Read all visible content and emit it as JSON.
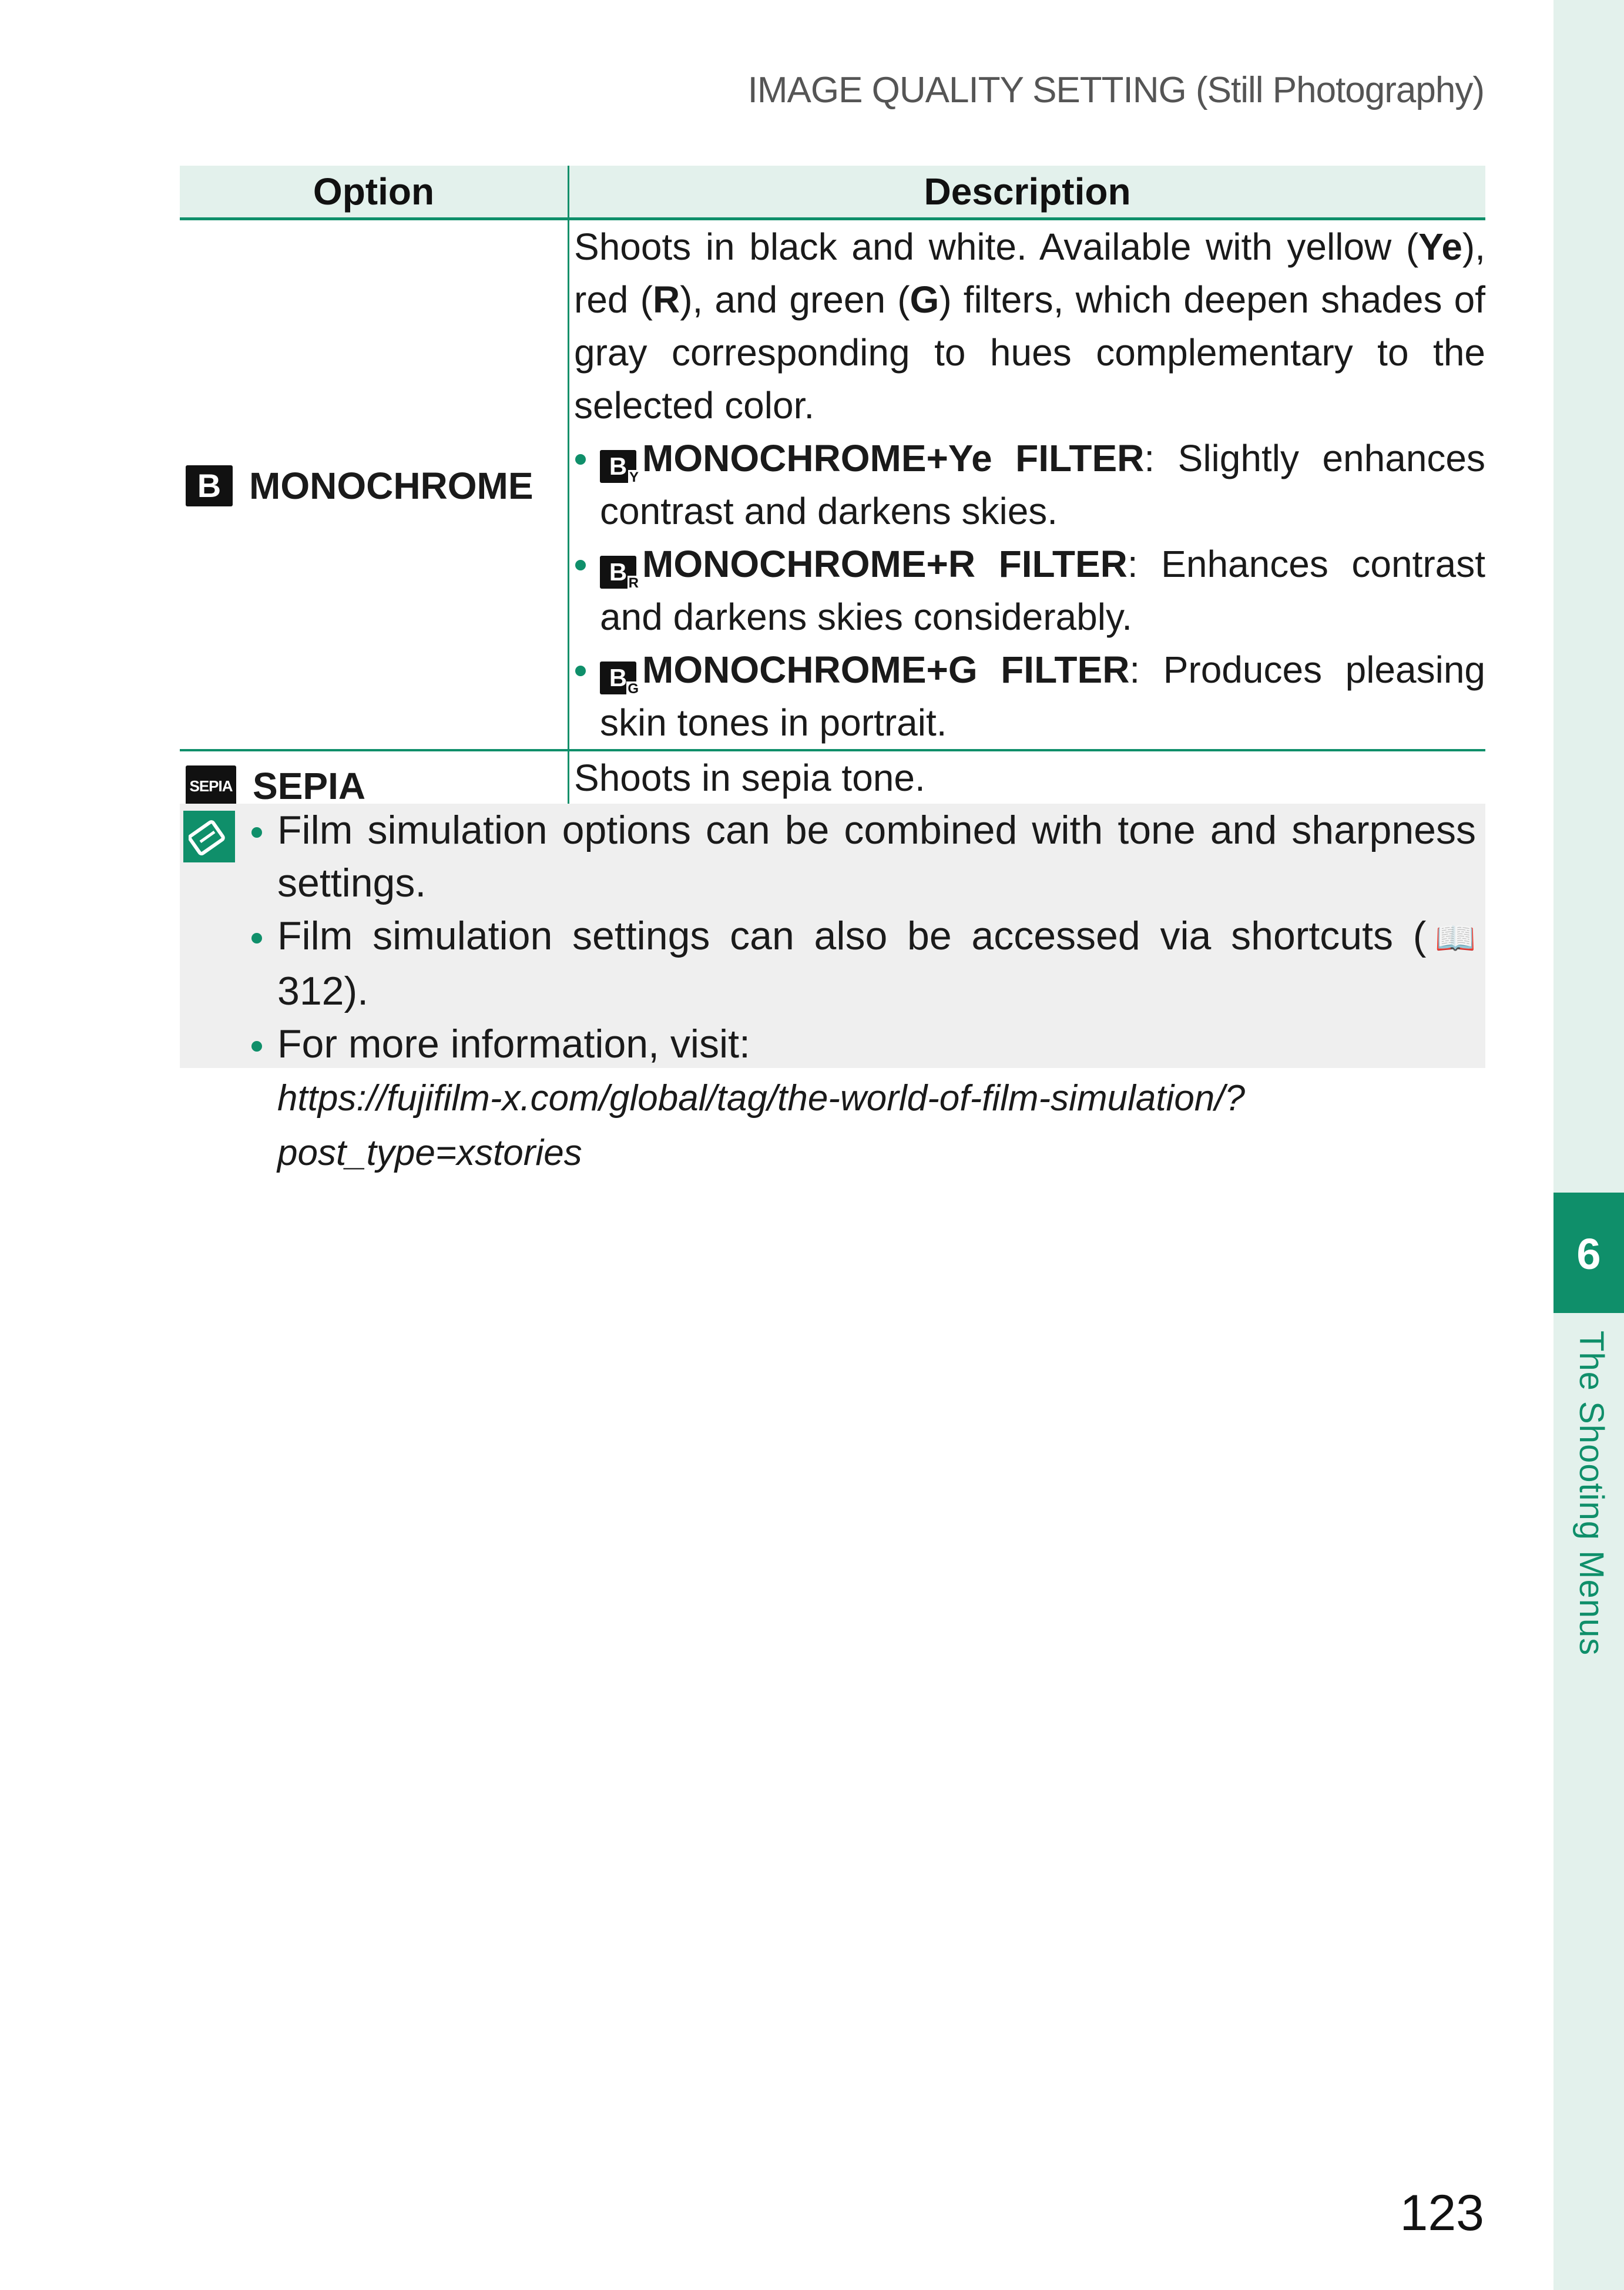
{
  "header": {
    "running_title": "IMAGE QUALITY SETTING (Still Photography)"
  },
  "table": {
    "col_option": "Option",
    "col_description": "Description",
    "monochrome": {
      "icon_text": "B",
      "label": "MONOCHROME",
      "intro": "Shoots in black and white. Available with yellow (Ye), red (R), and green (G) filters, which deepen shades of gray corresponding to hues complementary to the selected color.",
      "intro_parts": {
        "p1": "Shoots in black and white. Available with yellow (",
        "ye": "Ye",
        "p2": "), red (",
        "r": "R",
        "p3": "), and green (",
        "g": "G",
        "p4": ") filters, which deepen shades of gray corresponding to hues complementary to the selected color."
      },
      "filters": [
        {
          "icon_sub": "Y",
          "name": "MONOCHROME+Ye FILTER",
          "desc": ": Slightly enhances contrast and darkens skies."
        },
        {
          "icon_sub": "R",
          "name": "MONOCHROME+R FILTER",
          "desc": ": Enhances contrast and darkens skies considerably."
        },
        {
          "icon_sub": "G",
          "name": "MONOCHROME+G FILTER",
          "desc": ": Produces pleasing skin tones in portrait."
        }
      ]
    },
    "sepia": {
      "icon_text": "SEPIA",
      "label": "SEPIA",
      "desc": "Shoots in sepia tone."
    }
  },
  "note": {
    "items": [
      "Film simulation options can be combined with tone and sharpness settings.",
      "Film simulation settings can also be accessed via shortcuts (",
      "For more information, visit:"
    ],
    "page_ref": "312",
    "page_ref_suffix": ").",
    "url": "https://fujifilm-x.com/global/tag/the-world-of-film-simulation/?post_type=xstories"
  },
  "side_tab": {
    "number": "6",
    "label": "The Shooting Menus"
  },
  "footer": {
    "page_number": "123"
  },
  "colors": {
    "accent": "#0f8f6a",
    "tint": "#e3f1ec",
    "note_bg": "#efefef"
  },
  "icons": [
    "monochrome-icon",
    "monochrome-ye-icon",
    "monochrome-r-icon",
    "monochrome-g-icon",
    "sepia-icon",
    "note-icon",
    "book-icon"
  ]
}
